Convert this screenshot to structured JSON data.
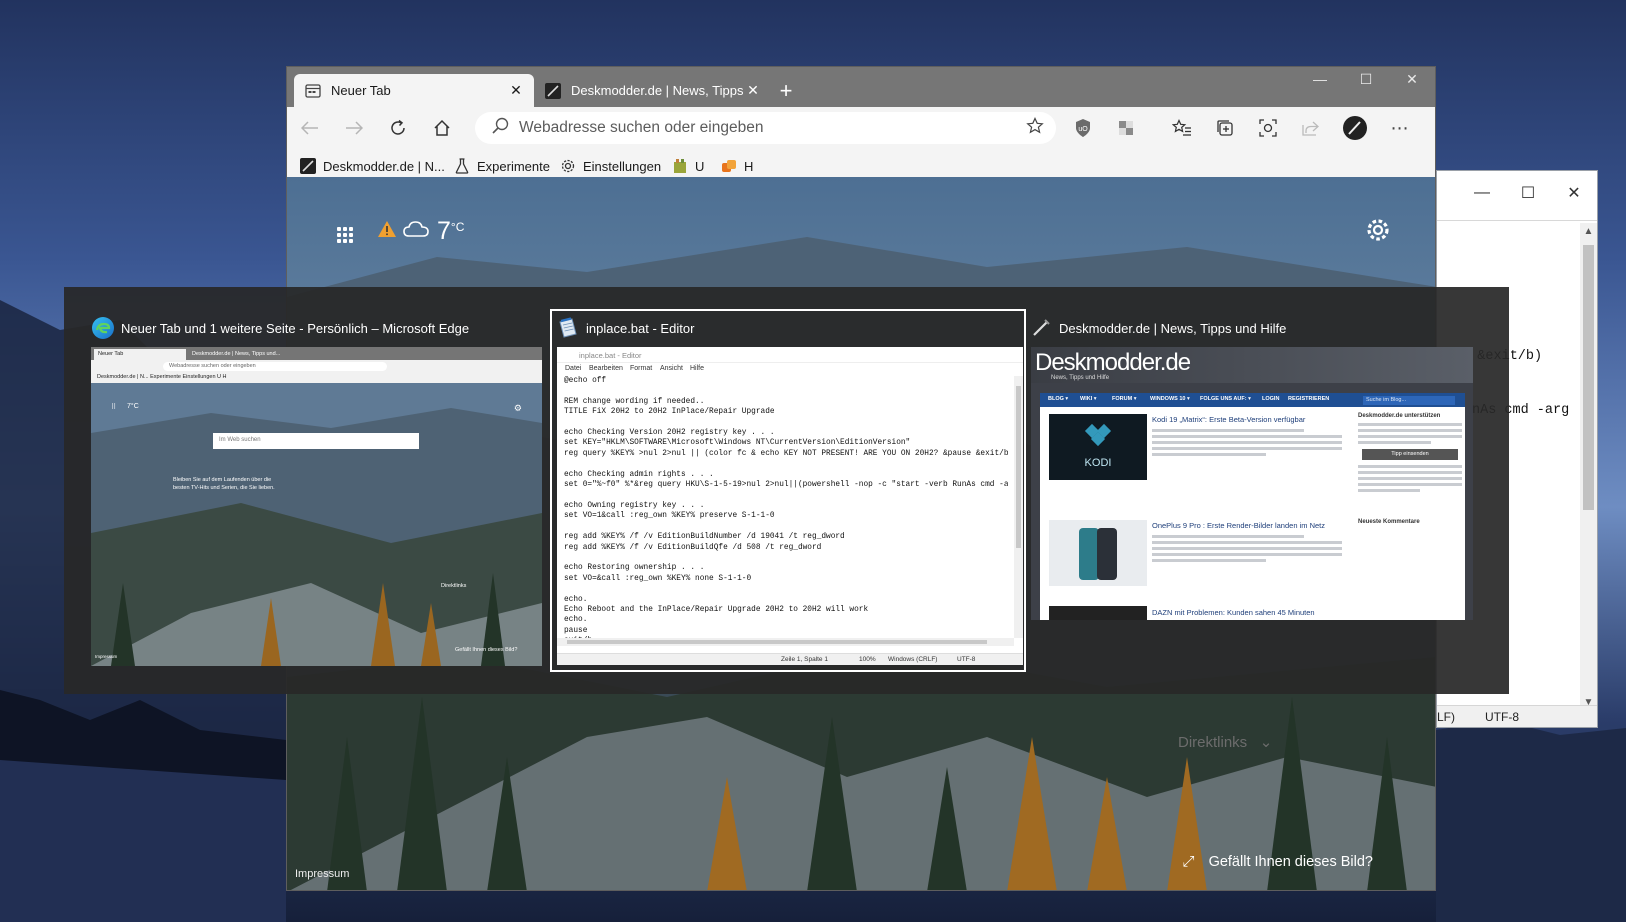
{
  "notepad_bg": {
    "code_lines": [
      "se &exit/b)",
      "nAs cmd -arg"
    ],
    "status": {
      "eol": "LF)",
      "encoding": "UTF-8"
    }
  },
  "edge": {
    "tabs": [
      {
        "label": "Neuer Tab"
      },
      {
        "label": "Deskmodder.de | News, Tipps und Hilfe"
      }
    ],
    "address_placeholder": "Webadresse suchen oder eingeben",
    "favorites": [
      {
        "label": "Deskmodder.de | N..."
      },
      {
        "label": "Experimente"
      },
      {
        "label": "Einstellungen"
      },
      {
        "label": "U"
      },
      {
        "label": "H"
      }
    ],
    "ntp": {
      "temperature": "7",
      "temperature_unit": "°C",
      "direktlinks": "Direktlinks",
      "impressum": "Impressum",
      "like_question": "Gefällt Ihnen dieses Bild?"
    }
  },
  "switcher": {
    "cards": [
      {
        "title": "Neuer Tab und 1 weitere Seite - Persönlich – Microsoft Edge"
      },
      {
        "title": "inplace.bat - Editor"
      },
      {
        "title": "Deskmodder.de | News, Tipps und Hilfe"
      }
    ],
    "edge_thumb": {
      "tab1": "Neuer Tab",
      "tab2": "Deskmodder.de | News, Tipps und...",
      "address": "Webadresse suchen oder eingeben",
      "favorites": "Deskmodder.de | N...    Experimente    Einstellungen    U    H",
      "temperature": "7°C",
      "search_placeholder": "Im Web suchen",
      "tip_line1": "Bleiben Sie auf dem Laufenden über die",
      "tip_line2": "besten TV-Hits und Serien, die Sie lieben.",
      "direktlinks": "Direktlinks",
      "impressum": "Impressum",
      "like_question": "Gefällt Ihnen dieses Bild?"
    },
    "notepad_thumb": {
      "title": "inplace.bat - Editor",
      "menu": [
        "Datei",
        "Bearbeiten",
        "Format",
        "Ansicht",
        "Hilfe"
      ],
      "code": "@echo off\n\nREM change wording if needed..\nTITLE FiX 20H2 to 20H2 InPlace/Repair Upgrade\n\necho Checking Version 20H2 registry key . . .\nset KEY=\"HKLM\\SOFTWARE\\Microsoft\\Windows NT\\CurrentVersion\\EditionVersion\"\nreg query %KEY% >nul 2>nul || (color fc & echo KEY NOT PRESENT! ARE YOU ON 20H2? &pause &exit/b)\n\necho Checking admin rights . . .\nset 0=\"%~f0\" %*&reg query HKU\\S-1-5-19>nul 2>nul||(powershell -nop -c \"start -verb RunAs cmd -arg\n\necho Owning registry key . . .\nset VO=1&call :reg_own %KEY% preserve S-1-1-0\n\nreg add %KEY% /f /v EditionBuildNumber /d 19041 /t reg_dword\nreg add %KEY% /f /v EditionBuildQfe /d 508 /t reg_dword\n\necho Restoring ownership . . .\nset VO=&call :reg_own %KEY% none S-1-1-0\n\necho.\nEcho Reboot and the InPlace/Repair Upgrade 20H2 to 20H2 will work\necho.\npause\nexit/b",
      "status_pos": "Zeile 1, Spalte 1",
      "status_zoom": "100%",
      "status_eol": "Windows (CRLF)",
      "status_enc": "UTF-8"
    },
    "deskmodder_thumb": {
      "logo": "Deskmodder.de",
      "subtitle": "News, Tipps und Hilfe",
      "nav": [
        "BLOG ▾",
        "WIKI ▾",
        "FORUM ▾",
        "WINDOWS 10 ▾",
        "FOLGE UNS AUF: ▾",
        "LOGIN",
        "REGISTRIEREN"
      ],
      "search": "Suche im Blog...",
      "posts": [
        {
          "title": "Kodi 19 „Matrix“: Erste Beta-Version verfügbar"
        },
        {
          "title": "OnePlus 9 Pro : Erste Render-Bilder landen im Netz"
        },
        {
          "title": "DAZN mit Problemen: Kunden sahen 45 Minuten"
        }
      ],
      "sidebar_head": "Deskmodder.de unterstützen",
      "sidebar_btn": "Tipp einsenden",
      "sidebar_head2": "Neueste Kommentare"
    }
  }
}
